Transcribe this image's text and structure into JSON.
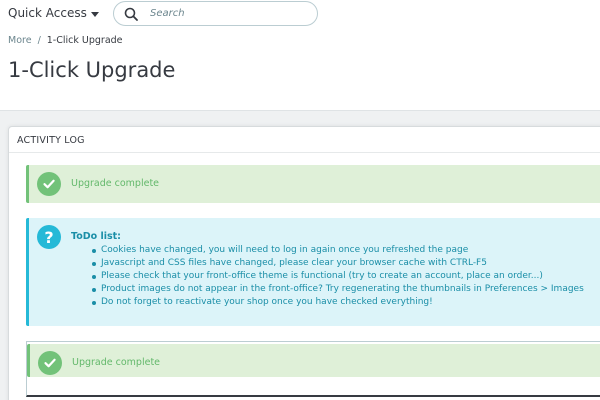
{
  "header": {
    "quick_access_label": "Quick Access",
    "search_placeholder": "Search"
  },
  "breadcrumb": {
    "parent": "More",
    "separator": "/",
    "current": "1-Click Upgrade"
  },
  "page_title": "1-Click Upgrade",
  "activity_log": {
    "heading": "ACTIVITY LOG",
    "alerts": [
      {
        "type": "success",
        "icon": "check-icon",
        "message": "Upgrade complete"
      },
      {
        "type": "info",
        "icon": "question-icon",
        "title": "ToDo list:",
        "items": [
          "Cookies have changed, you will need to log in again once you refreshed the page",
          "Javascript and CSS files have changed, please clear your browser cache with CTRL-F5",
          "Please check that your front-office theme is functional (try to create an account, place an order...)",
          "Product images do not appear in the front-office? Try regenerating the thumbnails in Preferences > Images",
          "Do not forget to reactivate your shop once you have checked everything!"
        ]
      },
      {
        "type": "success",
        "icon": "check-icon",
        "message": "Upgrade complete"
      }
    ]
  },
  "colors": {
    "success_bg": "#dff0d8",
    "success_accent": "#72c279",
    "info_bg": "#dcf4f9",
    "info_accent": "#25b9d7",
    "text_primary": "#363a41"
  }
}
